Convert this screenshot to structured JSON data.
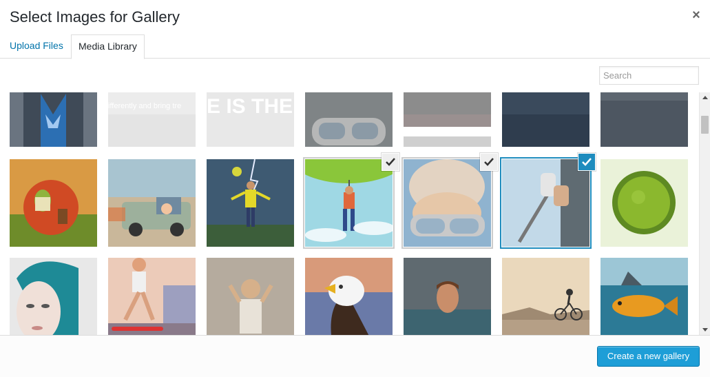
{
  "modal": {
    "title": "Select Images for Gallery",
    "close_icon": "close-icon"
  },
  "tabs": [
    {
      "label": "Upload Files",
      "active": false
    },
    {
      "label": "Media Library",
      "active": true
    }
  ],
  "search": {
    "placeholder": "Search",
    "value": ""
  },
  "grid": {
    "rows": [
      {
        "items": [
          {
            "name": "media-thumb-superhero-shirt",
            "overlay_text": "",
            "checked": false
          },
          {
            "name": "media-thumb-text-differently",
            "overlay_text": "ifferently and bring tre",
            "checked": false
          },
          {
            "name": "media-thumb-text-is-the",
            "overlay_text": "E IS THE",
            "checked": false
          },
          {
            "name": "media-thumb-goggles-cropped",
            "overlay_text": "",
            "checked": false
          },
          {
            "name": "media-thumb-room-cropped",
            "overlay_text": "",
            "checked": false
          },
          {
            "name": "media-thumb-dark-sky",
            "overlay_text": "",
            "checked": false
          },
          {
            "name": "media-thumb-grey-sky",
            "overlay_text": "",
            "checked": false
          }
        ]
      },
      {
        "items": [
          {
            "name": "media-thumb-apple-house",
            "checked": false
          },
          {
            "name": "media-thumb-truck-girl",
            "checked": false
          },
          {
            "name": "media-thumb-storm-man",
            "checked": false
          },
          {
            "name": "media-thumb-hanging-man",
            "checked": true
          },
          {
            "name": "media-thumb-goggles-face",
            "checked": true
          },
          {
            "name": "media-thumb-selfie-stick",
            "checked": true,
            "focused": true
          },
          {
            "name": "media-thumb-tiny-planet",
            "checked": false
          }
        ]
      },
      {
        "items": [
          {
            "name": "media-thumb-teal-hair-woman",
            "checked": false
          },
          {
            "name": "media-thumb-skater",
            "checked": false
          },
          {
            "name": "media-thumb-rain-child",
            "checked": false
          },
          {
            "name": "media-thumb-eagle",
            "checked": false
          },
          {
            "name": "media-thumb-water-head",
            "checked": false
          },
          {
            "name": "media-thumb-cyclist",
            "checked": false
          },
          {
            "name": "media-thumb-shark-fish",
            "checked": false
          }
        ]
      }
    ]
  },
  "toolbar": {
    "create_gallery_label": "Create a new gallery"
  },
  "colors": {
    "accent": "#1e8cbe",
    "button": "#1e9ed7",
    "link": "#0073aa"
  }
}
